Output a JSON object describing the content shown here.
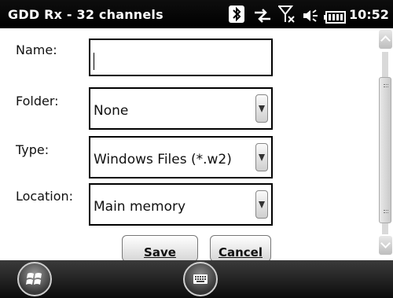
{
  "titlebar": {
    "title": "GDD Rx - 32 channels",
    "time": "10:52",
    "icons": [
      "bluetooth-icon",
      "sync-icon",
      "no-signal-icon",
      "volume-icon",
      "battery-icon"
    ]
  },
  "form": {
    "name": {
      "label": "Name:",
      "value": ""
    },
    "folder": {
      "label": "Folder:",
      "value": "None"
    },
    "type": {
      "label": "Type:",
      "value": "Windows Files (*.w2)"
    },
    "location": {
      "label": "Location:",
      "value": "Main memory"
    }
  },
  "buttons": {
    "save": "Save",
    "cancel": "Cancel"
  },
  "taskbar": {
    "icons": [
      "windows-start-icon",
      "keyboard-icon"
    ]
  }
}
